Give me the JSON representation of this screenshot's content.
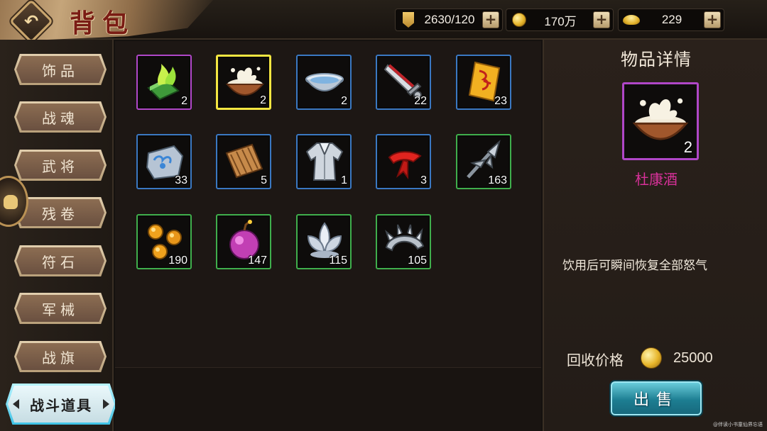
{
  "header": {
    "title": "背包",
    "back_icon": "back-arrow-icon",
    "resources": [
      {
        "name": "stamina",
        "icon": "banner-icon",
        "value": "2630/120"
      },
      {
        "name": "silver",
        "icon": "coin-icon",
        "value": "170万"
      },
      {
        "name": "gold",
        "icon": "ingot-icon",
        "value": "229"
      }
    ],
    "plus_label": "+"
  },
  "tabs": [
    {
      "label": "饰品",
      "active": false
    },
    {
      "label": "战魂",
      "active": false
    },
    {
      "label": "武将",
      "active": false
    },
    {
      "label": "残卷",
      "active": false
    },
    {
      "label": "符石",
      "active": false
    },
    {
      "label": "军械",
      "active": false
    },
    {
      "label": "战旗",
      "active": false
    },
    {
      "label": "战斗道具",
      "active": true
    }
  ],
  "inventory": [
    {
      "icon": "green-flame-book-icon",
      "count": "2",
      "rarity": "purple"
    },
    {
      "icon": "wine-bowl-icon",
      "count": "2",
      "rarity": "purple",
      "selected": true
    },
    {
      "icon": "water-bowl-icon",
      "count": "2",
      "rarity": "blue"
    },
    {
      "icon": "broken-sword-icon",
      "count": "22",
      "rarity": "blue"
    },
    {
      "icon": "talisman-scroll-icon",
      "count": "23",
      "rarity": "blue"
    },
    {
      "icon": "cloud-stone-icon",
      "count": "33",
      "rarity": "blue"
    },
    {
      "icon": "bamboo-scroll-icon",
      "count": "5",
      "rarity": "blue"
    },
    {
      "icon": "robe-icon",
      "count": "1",
      "rarity": "blue"
    },
    {
      "icon": "red-scarf-icon",
      "count": "3",
      "rarity": "blue"
    },
    {
      "icon": "arrowhead-icon",
      "count": "163",
      "rarity": "green"
    },
    {
      "icon": "golden-pellets-icon",
      "count": "190",
      "rarity": "green"
    },
    {
      "icon": "purple-bomb-icon",
      "count": "147",
      "rarity": "green"
    },
    {
      "icon": "lotus-icon",
      "count": "115",
      "rarity": "green"
    },
    {
      "icon": "spiked-ring-icon",
      "count": "105",
      "rarity": "green"
    }
  ],
  "detail": {
    "title": "物品详情",
    "item_icon": "wine-bowl-icon",
    "item_count": "2",
    "item_name": "杜康酒",
    "description": "饮用后可瞬间恢复全部怒气",
    "price_label": "回收价格",
    "price_value": "25000",
    "sell_label": "出售"
  },
  "colors": {
    "rarity_purple": "#b047c8",
    "rarity_blue": "#3a78c2",
    "rarity_green": "#3fae4c",
    "selected": "#f4e641",
    "item_name": "#d8319a",
    "sell_button": "#1d7e92"
  },
  "watermark": "@伴读小书童仙界忘语"
}
